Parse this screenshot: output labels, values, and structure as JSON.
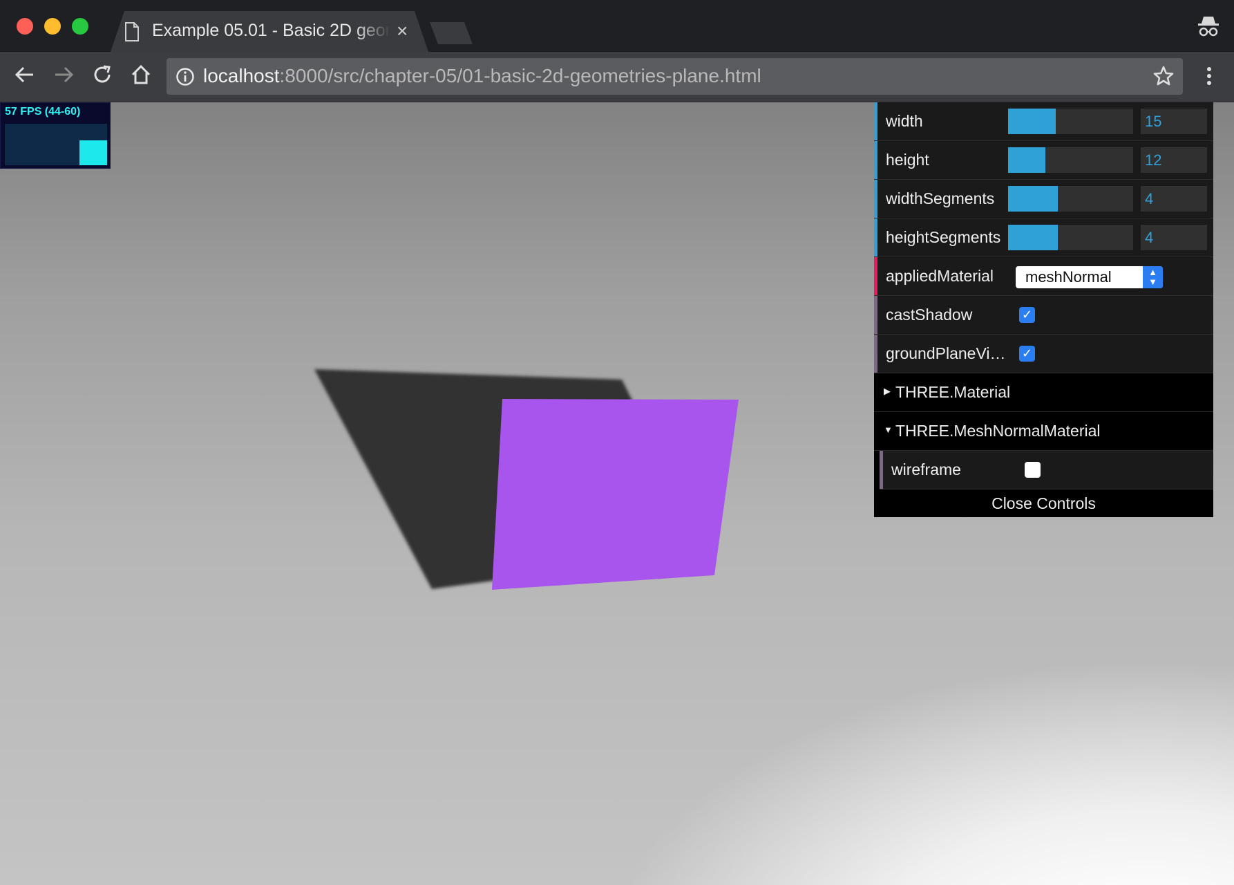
{
  "browser": {
    "tab_title": "Example 05.01 - Basic 2D geometries - Plane",
    "tab_close": "×",
    "url_host": "localhost",
    "url_rest": ":8000/src/chapter-05/01-basic-2d-geometries-plane.html",
    "traffic_colors": [
      "#fe5f57",
      "#febc2e",
      "#28c840"
    ]
  },
  "stats": {
    "fps_text": "57 FPS (44-60)",
    "fps": 57,
    "min": 44,
    "max": 60
  },
  "gui": {
    "controls": [
      {
        "label": "width",
        "value": "15",
        "fill": 0.38
      },
      {
        "label": "height",
        "value": "12",
        "fill": 0.3
      },
      {
        "label": "widthSegments",
        "value": "4",
        "fill": 0.4
      },
      {
        "label": "heightSegments",
        "value": "4",
        "fill": 0.4
      }
    ],
    "applied_material": {
      "label": "appliedMaterial",
      "value": "meshNormal"
    },
    "cast_shadow": {
      "label": "castShadow",
      "checked": true
    },
    "ground_plane": {
      "label": "groundPlaneVi…",
      "checked": true
    },
    "folders": [
      {
        "label": "THREE.Material",
        "open": false
      },
      {
        "label": "THREE.MeshNormalMaterial",
        "open": true
      }
    ],
    "wireframe": {
      "label": "wireframe",
      "checked": false
    },
    "close_label": "Close Controls",
    "accent_colors": {
      "number": "#2fa1d6",
      "option": "#e61d5f",
      "boolean": "#806787"
    }
  },
  "scene": {
    "plane_color": "#a855ee",
    "shadow_color": "#333333"
  }
}
